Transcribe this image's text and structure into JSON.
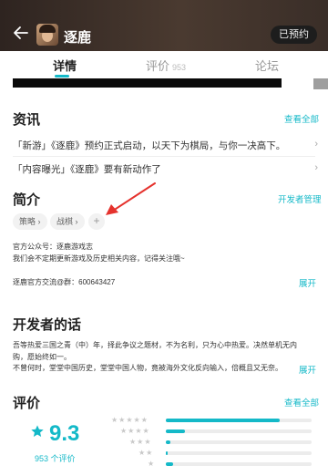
{
  "header": {
    "title": "逐鹿",
    "reserved_label": "已预约"
  },
  "tabs": [
    {
      "label": "详情",
      "count": ""
    },
    {
      "label": "评价",
      "count": "953"
    },
    {
      "label": "论坛",
      "count": ""
    }
  ],
  "news": {
    "title": "资讯",
    "view_all": "查看全部",
    "items": [
      {
        "text": "「新游」《逐鹿》预约正式启动，以天下为棋局，与你一决高下。"
      },
      {
        "text": "「内容曝光」《逐鹿》要有新动作了"
      }
    ]
  },
  "intro": {
    "title": "简介",
    "manage_link": "开发者管理",
    "tags": [
      "策略 ›",
      "战棋 ›"
    ],
    "add_tag": "+",
    "official_account": "官方公众号：逐鹿游戏志",
    "follow_note": "我们会不定期更新游戏及历史相关内容，记得关注哦~",
    "qq_group": "逐鹿官方交流@群：600643427",
    "expand": "展开"
  },
  "developer": {
    "title": "开发者的话",
    "line1": "吾等热爱三国之青（中）年，择此争议之题材，不为名利，只为心中热爱。决然单机无内购，愿始终如一。",
    "line2": "不曾何时，堂堂中国历史，堂堂中国人物，竟被海外文化反向输入，倍概且又无奈。",
    "expand": "展开"
  },
  "ratings": {
    "title": "评价",
    "view_all": "查看全部",
    "score": "9.3",
    "count_text": "953 个评价",
    "accent_color": "#14b9c8",
    "distribution": [
      {
        "stars": "★★★★★",
        "fraction": 0.78
      },
      {
        "stars": "★★★★",
        "fraction": 0.13
      },
      {
        "stars": "★★★",
        "fraction": 0.03
      },
      {
        "stars": "★★",
        "fraction": 0.01
      },
      {
        "stars": "★",
        "fraction": 0.05
      }
    ]
  },
  "icons": {
    "back": "back-arrow-icon",
    "rating_star": "star-icon"
  }
}
